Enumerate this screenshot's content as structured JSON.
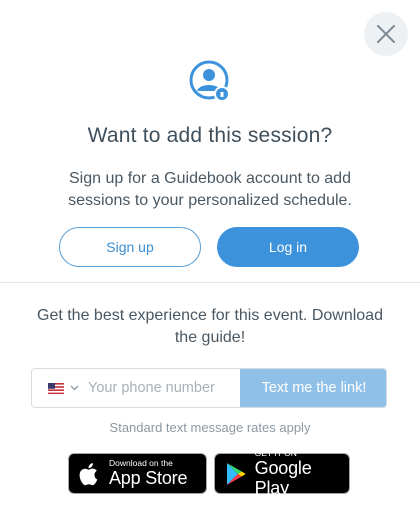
{
  "header": {
    "close_icon": "close-icon",
    "user_icon": "user-lock-icon",
    "title": "Want to add this session?",
    "subtitle": "Sign up for a Guidebook account to add sessions to your personalized schedule."
  },
  "auth": {
    "signup_label": "Sign up",
    "login_label": "Log in"
  },
  "download": {
    "text": "Get the best experience for this event. Download the guide!",
    "phone_placeholder": "Your phone number",
    "country_flag": "us-flag-icon",
    "send_label": "Text me the link!",
    "rates_text": "Standard text message rates apply",
    "appstore": {
      "small": "Download on the",
      "big": "App Store"
    },
    "googleplay": {
      "small": "GET IT ON",
      "big": "Google Play"
    }
  },
  "colors": {
    "accent": "#3d93db",
    "accent_light": "#8fc0e8",
    "text": "#3f4f5b"
  }
}
